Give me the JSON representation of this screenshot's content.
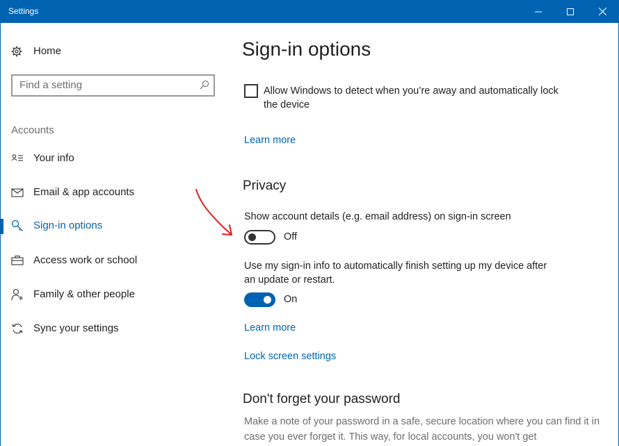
{
  "window": {
    "title": "Settings",
    "accent_color": "#0063b1"
  },
  "sidebar": {
    "home_label": "Home",
    "home_icon": "gear-icon",
    "search": {
      "placeholder": "Find a setting",
      "icon": "search-icon"
    },
    "section_label": "Accounts",
    "items": [
      {
        "label": "Your info",
        "icon": "person-card-icon",
        "selected": false
      },
      {
        "label": "Email & app accounts",
        "icon": "mail-icon",
        "selected": false
      },
      {
        "label": "Sign-in options",
        "icon": "key-icon",
        "selected": true
      },
      {
        "label": "Access work or school",
        "icon": "briefcase-icon",
        "selected": false
      },
      {
        "label": "Family & other people",
        "icon": "person-add-icon",
        "selected": false
      },
      {
        "label": "Sync your settings",
        "icon": "sync-icon",
        "selected": false
      }
    ]
  },
  "main": {
    "title": "Sign-in options",
    "away_lock": {
      "label": "Allow Windows to detect when you’re away and automatically lock the device",
      "checked": false
    },
    "learn_more_1": "Learn more",
    "privacy": {
      "heading": "Privacy",
      "show_details": {
        "label": "Show account details (e.g. email address) on sign-in screen",
        "state": "Off",
        "on": false
      },
      "auto_finish": {
        "label": "Use my sign-in info to automatically finish setting up my device after an update or restart.",
        "state": "On",
        "on": true
      },
      "learn_more": "Learn more",
      "lock_screen_link": "Lock screen settings"
    },
    "password": {
      "heading": "Don't forget your password",
      "body": "Make a note of your password in a safe, secure location where you can find it in case you ever forget it. This way, for local accounts, you won't get"
    }
  },
  "annotation": {
    "type": "red-arrow",
    "color": "#e02020"
  }
}
